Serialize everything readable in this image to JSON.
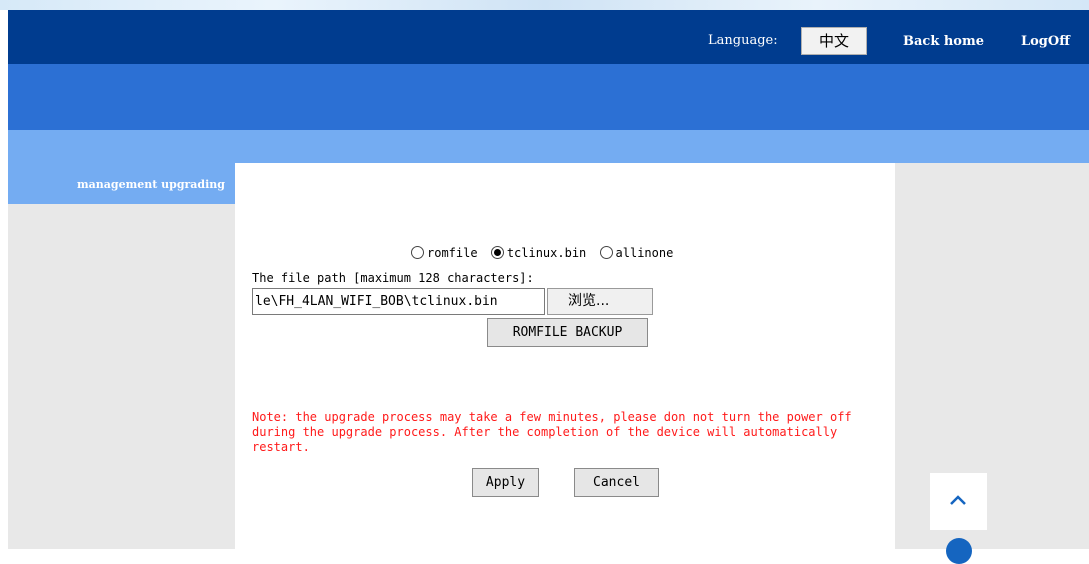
{
  "header": {
    "language_label": "Language:",
    "language_button": "中文",
    "back_home": "Back home",
    "logoff": "LogOff"
  },
  "sidebar": {
    "items": [
      {
        "label": "management upgrading",
        "active": true
      }
    ]
  },
  "upgrade": {
    "radio_options": [
      {
        "label": "romfile",
        "checked": false
      },
      {
        "label": "tclinux.bin",
        "checked": true
      },
      {
        "label": "allinone",
        "checked": false
      }
    ],
    "path_label": "The file path [maximum 128 characters]:",
    "file_path_value": "le\\FH_4LAN_WIFI_BOB\\tclinux.bin",
    "browse_button": "浏览...",
    "romfile_backup_button": "ROMFILE BACKUP",
    "note": "Note: the upgrade process may take a few minutes, please don not turn the power off during the upgrade process. After the completion of the device will automatically restart.",
    "apply_button": "Apply",
    "cancel_button": "Cancel"
  },
  "colors": {
    "top_bar": "#003c8f",
    "banner": "#2c70d4",
    "sub_bar": "#74acf2",
    "side_panel": "#e8e8e8",
    "note_text": "#ff1a1a"
  },
  "icons": {
    "scroll_top": "chevron-up-icon"
  }
}
